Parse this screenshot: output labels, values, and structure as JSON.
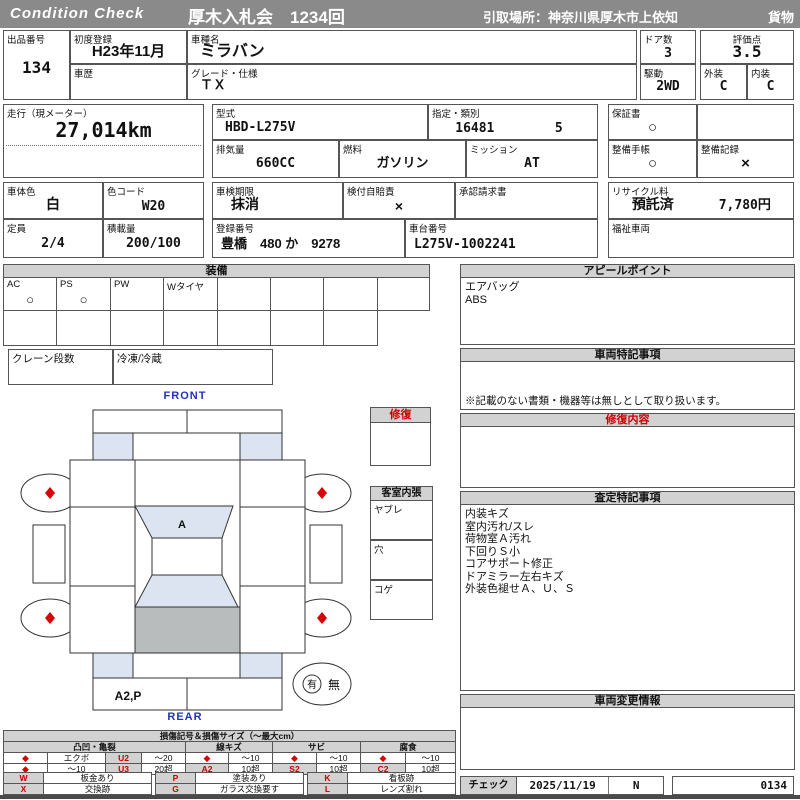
{
  "title_bar": {
    "brand": "Condition Check",
    "auction_title": "厚木入札会　1234回",
    "pickup": "引取場所：神奈川県厚木市上依知",
    "category": "貨物"
  },
  "info": {
    "lot_no": {
      "label": "出品番号",
      "value": "134"
    },
    "first_reg": {
      "label": "初度登録",
      "value": "H23年11月"
    },
    "history": {
      "label": "車歴",
      "value": ""
    },
    "model_name": {
      "label": "車種名",
      "value": "ミラバン"
    },
    "grade": {
      "label": "グレード・仕様",
      "value": "ＴＸ"
    },
    "doors": {
      "label": "ドア数",
      "value": "3"
    },
    "drive": {
      "label": "駆動",
      "value": "2WD"
    },
    "score": {
      "label": "評価点",
      "value": "3.5"
    },
    "exterior": {
      "label": "外装",
      "value": "C"
    },
    "interior": {
      "label": "内装",
      "value": "C"
    },
    "mileage": {
      "label": "走行（現メーター）",
      "value": "27,014km"
    },
    "model_code": {
      "label": "型式",
      "value": "HBD-L275V"
    },
    "class_no": {
      "label": "指定・類別",
      "value": "16481",
      "value2": "5"
    },
    "displacement": {
      "label": "排気量",
      "value": "660CC"
    },
    "fuel": {
      "label": "燃料",
      "value": "ガソリン"
    },
    "transmission": {
      "label": "ミッション",
      "value": "AT"
    },
    "warranty_book": {
      "label": "保証書",
      "value": "○"
    },
    "maintenance_book": {
      "label": "整備手帳",
      "value": "○"
    },
    "maintenance_record": {
      "label": "整備記録",
      "value": "×"
    },
    "body_color": {
      "label": "車体色",
      "value": "白"
    },
    "color_code": {
      "label": "色コード",
      "value": "W20"
    },
    "capacity": {
      "label": "定員",
      "value": "2/4"
    },
    "load_capacity": {
      "label": "積載量",
      "value": "200/100"
    },
    "inspection": {
      "label": "車検期限",
      "value": "抹消"
    },
    "insurance": {
      "label": "検付自賠責",
      "value": "×"
    },
    "approval_request": {
      "label": "承認請求書",
      "value": ""
    },
    "reg_number": {
      "label": "登録番号",
      "value": "豊橋　480 か　9278"
    },
    "chassis_no": {
      "label": "車台番号",
      "value": "L275V-1002241"
    },
    "recycle_fee": {
      "label": "リサイクル料",
      "status": "預託済",
      "amount": "7,780円"
    },
    "welfare": {
      "label": "福祉車両",
      "value": ""
    }
  },
  "equipment": {
    "header": "装備",
    "cells": [
      {
        "label": "AC",
        "value": "○"
      },
      {
        "label": "PS",
        "value": "○"
      },
      {
        "label": "PW",
        "value": ""
      },
      {
        "label": "Wタイヤ",
        "value": ""
      }
    ],
    "crane_label": "クレーン段数",
    "fridge_label": "冷凍/冷蔵"
  },
  "diagram": {
    "front_label": "FRONT",
    "rear_label": "REAR",
    "windshield_mark": "A",
    "rear_bumper_mark": "A2,P",
    "spare_yes": "有",
    "spare_no": "無"
  },
  "repair_box_header": "修復",
  "cabin": {
    "header": "客室内張",
    "tear": "ヤブレ",
    "hole": "穴",
    "burn": "コゲ"
  },
  "right": {
    "appeal": {
      "header": "アピールポイント",
      "lines": [
        "エアバッグ",
        "ABS"
      ]
    },
    "vehicle_notes": {
      "header": "車両特記事項",
      "note": "※記載のない書類・機器等は無しとして取り扱います。"
    },
    "repair_detail": {
      "header": "修復内容"
    },
    "assessment": {
      "header": "査定特記事項",
      "lines": [
        "内装キズ",
        "室内汚れ/スレ",
        "荷物室Ａ汚れ",
        "下回りＳ小",
        "コアサポート修正",
        "ドアミラー左右キズ",
        "外装色褪せＡ、Ｕ、Ｓ"
      ]
    },
    "change_info": {
      "header": "車両変更情報"
    },
    "check": {
      "label": "チェック",
      "date": "2025/11/19",
      "inspector": "N",
      "sheet_no": "0134"
    }
  },
  "legend": {
    "title": "損傷記号＆損傷サイズ（〜最大cm）",
    "groups": [
      {
        "header": "凸凹・亀裂",
        "r1": [
          "◆",
          "エクボ",
          "U2",
          "〜20"
        ],
        "r2": [
          "◆",
          "〜10",
          "U3",
          "20超"
        ]
      },
      {
        "header": "線キズ",
        "r1": [
          "◆",
          "〜10"
        ],
        "r2": [
          "A2",
          "10超"
        ]
      },
      {
        "header": "サビ",
        "r1": [
          "◆",
          "〜10"
        ],
        "r2": [
          "S2",
          "10超"
        ]
      },
      {
        "header": "腐食",
        "r1": [
          "◆",
          "〜10"
        ],
        "r2": [
          "C2",
          "10超"
        ]
      }
    ],
    "codes": [
      {
        "code": "W",
        "desc": "板金あり"
      },
      {
        "code": "X",
        "desc": "交換跡"
      },
      {
        "code": "P",
        "desc": "塗装あり"
      },
      {
        "code": "G",
        "desc": "ガラス交換要す"
      },
      {
        "code": "K",
        "desc": "看板跡"
      },
      {
        "code": "L",
        "desc": "レンズ割れ"
      }
    ]
  },
  "colors": {
    "bar_gray": "#8a8a8a",
    "header_gray": "#d2d2d2",
    "accent_red": "#cc0000",
    "label_blue": "#2233bb",
    "glass_blue": "#dbe4f0",
    "panel_gray": "#b9bcbd"
  }
}
